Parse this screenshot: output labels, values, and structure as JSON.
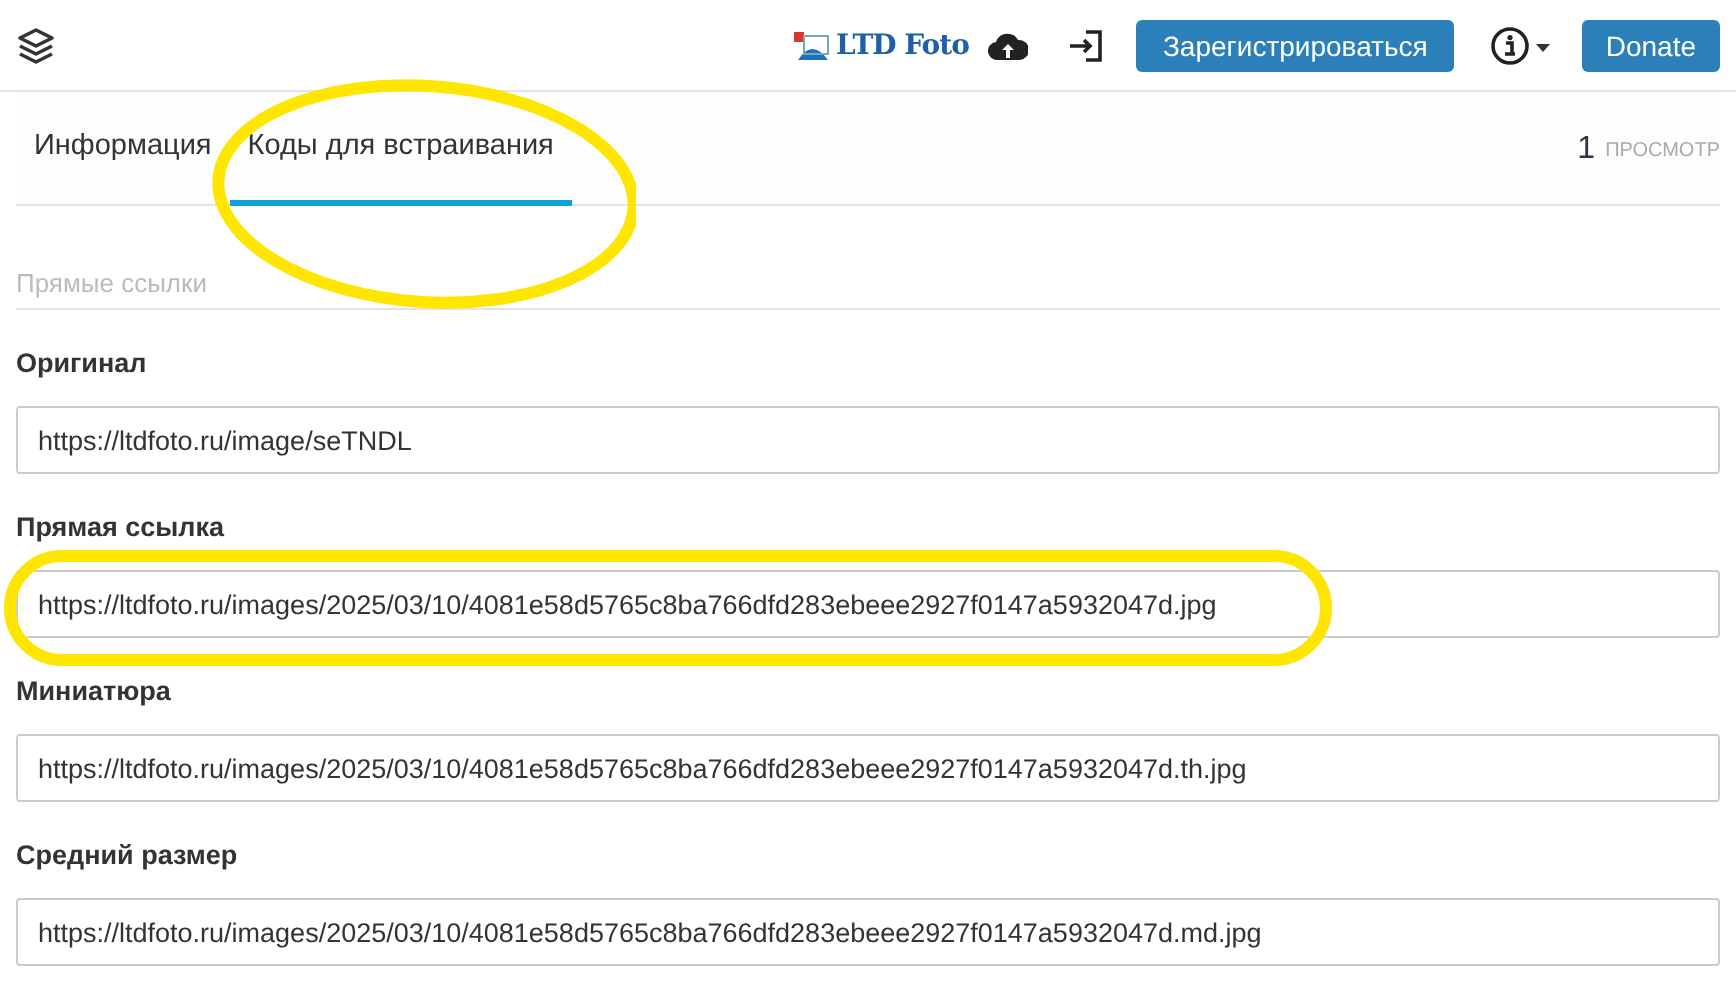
{
  "header": {
    "logo": "LTD Foto",
    "register_button": "Зарегистрироваться",
    "donate_button": "Donate"
  },
  "tabs": [
    {
      "label": "Информация",
      "selected": false,
      "highlighted": false
    },
    {
      "label": "Коды для встраивания",
      "selected": true,
      "highlighted": true
    }
  ],
  "views": {
    "count": "1",
    "label": "ПРОСМОТР"
  },
  "section_title": "Прямые ссылки",
  "fields": [
    {
      "label": "Оригинал",
      "value": "https://ltdfoto.ru/image/seTNDL",
      "highlighted": false
    },
    {
      "label": "Прямая ссылка",
      "value": "https://ltdfoto.ru/images/2025/03/10/4081e58d5765c8ba766dfd283ebeee2927f0147a5932047d.jpg",
      "highlighted": true
    },
    {
      "label": "Миниатюра",
      "value": "https://ltdfoto.ru/images/2025/03/10/4081e58d5765c8ba766dfd283ebeee2927f0147a5932047d.th.jpg",
      "highlighted": false
    },
    {
      "label": "Средний размер",
      "value": "https://ltdfoto.ru/images/2025/03/10/4081e58d5765c8ba766dfd283ebeee2927f0147a5932047d.md.jpg",
      "highlighted": false
    }
  ]
}
